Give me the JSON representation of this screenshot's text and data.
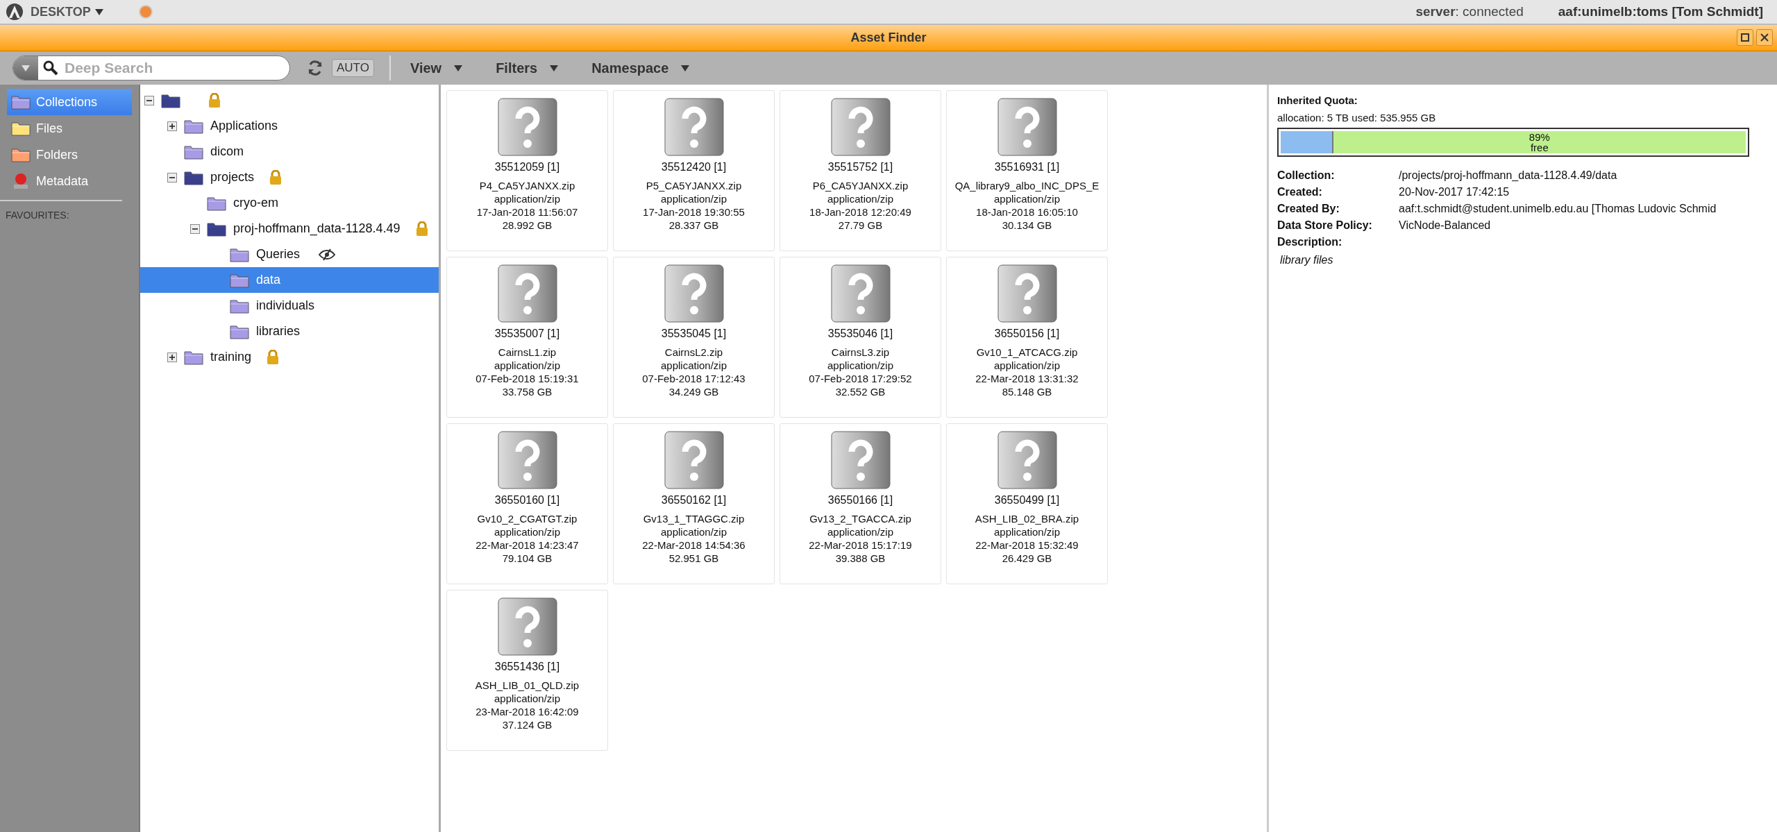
{
  "top_bar": {
    "menu": "DESKTOP",
    "server": "**server**: connected",
    "user": "aaf:unimelb:toms [Tom Schmidt]"
  },
  "window": {
    "title": "Asset Finder"
  },
  "toolbar": {
    "search_placeholder": "Deep Search",
    "auto": "AUTO",
    "menus": [
      "View",
      "Filters",
      "Namespace"
    ]
  },
  "sidebar": {
    "items": [
      {
        "label": "Collections",
        "kind": "collections",
        "selected": true
      },
      {
        "label": "Files",
        "kind": "files",
        "selected": false
      },
      {
        "label": "Folders",
        "kind": "folders",
        "selected": false
      },
      {
        "label": "Metadata",
        "kind": "metadata",
        "selected": false
      }
    ],
    "favourites": "FAVOURITES:"
  },
  "tree": {
    "expanded": true,
    "locked": true,
    "selected": false,
    "children": [
      {
        "label": "Applications",
        "expanded": false,
        "locked": false,
        "selected": false
      },
      {
        "label": "dicom",
        "locked": false,
        "selected": false
      },
      {
        "label": "projects",
        "expanded": true,
        "locked": true,
        "selected": false,
        "children": [
          {
            "label": "cryo-em",
            "locked": false,
            "selected": false
          },
          {
            "label": "proj-hoffmann_data-1128.4.49",
            "expanded": true,
            "locked": true,
            "selected": false,
            "children": [
              {
                "label": "Queries",
                "locked": false,
                "hidden": true,
                "selected": false
              },
              {
                "label": "data",
                "locked": false,
                "selected": true
              },
              {
                "label": "individuals",
                "locked": false,
                "selected": false
              },
              {
                "label": "libraries",
                "locked": false,
                "selected": false
              }
            ]
          }
        ]
      },
      {
        "label": "training",
        "expanded": false,
        "locked": true,
        "selected": false
      }
    ]
  },
  "assets": [
    {
      "id": "35512059 [1]",
      "name": "P4_CA5YJANXX.zip",
      "type": "application/zip",
      "date": "17-Jan-2018 11:56:07",
      "size": "28.992 GB"
    },
    {
      "id": "35512420 [1]",
      "name": "P5_CA5YJANXX.zip",
      "type": "application/zip",
      "date": "17-Jan-2018 19:30:55",
      "size": "28.337 GB"
    },
    {
      "id": "35515752 [1]",
      "name": "P6_CA5YJANXX.zip",
      "type": "application/zip",
      "date": "18-Jan-2018 12:20:49",
      "size": "27.79 GB"
    },
    {
      "id": "35516931 [1]",
      "name": "QA_library9_albo_INC_DPS_E",
      "type": "application/zip",
      "date": "18-Jan-2018 16:05:10",
      "size": "30.134 GB"
    },
    {
      "id": "35535007 [1]",
      "name": "CairnsL1.zip",
      "type": "application/zip",
      "date": "07-Feb-2018 15:19:31",
      "size": "33.758 GB"
    },
    {
      "id": "35535045 [1]",
      "name": "CairnsL2.zip",
      "type": "application/zip",
      "date": "07-Feb-2018 17:12:43",
      "size": "34.249 GB"
    },
    {
      "id": "35535046 [1]",
      "name": "CairnsL3.zip",
      "type": "application/zip",
      "date": "07-Feb-2018 17:29:52",
      "size": "32.552 GB"
    },
    {
      "id": "36550156 [1]",
      "name": "Gv10_1_ATCACG.zip",
      "type": "application/zip",
      "date": "22-Mar-2018 13:31:32",
      "size": "85.148 GB"
    },
    {
      "id": "36550160 [1]",
      "name": "Gv10_2_CGATGT.zip",
      "type": "application/zip",
      "date": "22-Mar-2018 14:23:47",
      "size": "79.104 GB"
    },
    {
      "id": "36550162 [1]",
      "name": "Gv13_1_TTAGGC.zip",
      "type": "application/zip",
      "date": "22-Mar-2018 14:54:36",
      "size": "52.951 GB"
    },
    {
      "id": "36550166 [1]",
      "name": "Gv13_2_TGACCA.zip",
      "type": "application/zip",
      "date": "22-Mar-2018 15:17:19",
      "size": "39.388 GB"
    },
    {
      "id": "36550499 [1]",
      "name": "ASH_LIB_02_BRA.zip",
      "type": "application/zip",
      "date": "22-Mar-2018 15:32:49",
      "size": "26.429 GB"
    },
    {
      "id": "36551436 [1]",
      "name": "ASH_LIB_01_QLD.zip",
      "type": "application/zip",
      "date": "23-Mar-2018 16:42:09",
      "size": "37.124 GB"
    }
  ],
  "details": {
    "quota_title": "Inherited Quota:",
    "allocation": "allocation: 5 TB used: 535.955 GB",
    "quota": {
      "level": 0.11,
      "percent": "89%",
      "free": "free"
    },
    "fields": [
      {
        "label": "Collection:",
        "value": "/projects/proj-hoffmann_data-1128.4.49/data"
      },
      {
        "label": "Created:",
        "value": "20-Nov-2017 17:42:15"
      },
      {
        "label": "Created By:",
        "value": "aaf:t.schmidt@student.unimelb.edu.au [Thomas Ludovic Schmid"
      },
      {
        "label": "Data Store Policy:",
        "value": "VicNode-Balanced"
      },
      {
        "label": "Description:"
      }
    ],
    "description": "library files"
  }
}
